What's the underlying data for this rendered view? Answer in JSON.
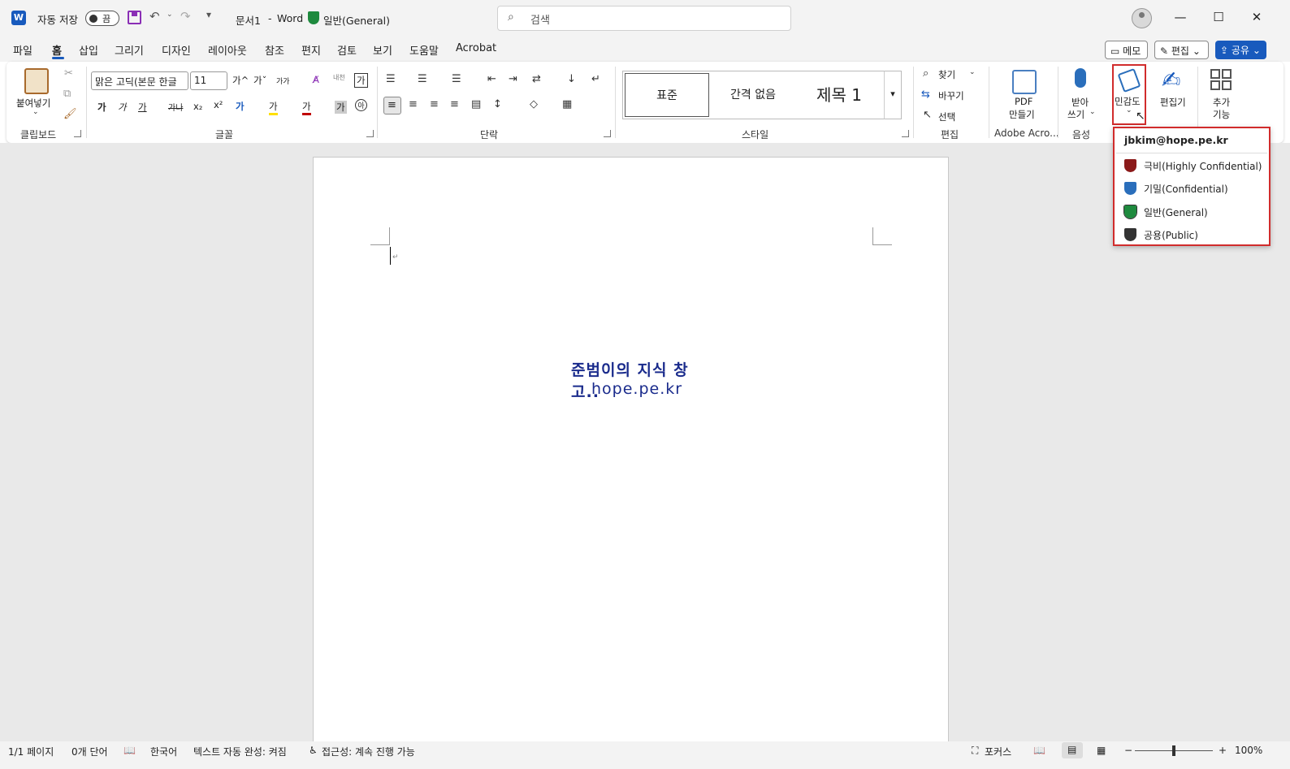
{
  "titlebar": {
    "app_icon": "W",
    "autosave_label": "자동 저장",
    "autosave_state": "끔",
    "doc_title": "문서1",
    "separator": "-",
    "app_name": "Word",
    "sensitivity_label": "일반(General)",
    "search_placeholder": "검색",
    "icons": [
      "save-icon",
      "undo-icon",
      "redo-icon",
      "customize-icon",
      "search-icon",
      "account-icon",
      "minimize-icon",
      "maximize-icon",
      "close-icon"
    ]
  },
  "tabs": [
    "파일",
    "홈",
    "삽입",
    "그리기",
    "디자인",
    "레이아웃",
    "참조",
    "편지",
    "검토",
    "보기",
    "도움말",
    "Acrobat"
  ],
  "active_tab": "홈",
  "top_buttons": {
    "memo": "메모",
    "edit": "편집",
    "share": "공유"
  },
  "ribbon": {
    "clipboard": {
      "paste_label": "붙여넣기",
      "group_label": "클립보드"
    },
    "font": {
      "font_name": "맑은 고딕(본문 한글",
      "font_size": "11",
      "row1": [
        "가^",
        "가ˇ",
        "가가",
        "내천",
        "가"
      ],
      "row2": [
        "가",
        "가",
        "가",
        "가나",
        "x₂",
        "x²",
        "가",
        "가",
        "가",
        "가"
      ],
      "group_label": "글꼴"
    },
    "paragraph": {
      "group_label": "단락"
    },
    "styles": {
      "items": [
        "표준",
        "간격 없음",
        "제목 1"
      ],
      "group_label": "스타일"
    },
    "editing": {
      "find": "찾기",
      "replace": "바꾸기",
      "select": "선택",
      "group_label": "편집"
    },
    "adobe": {
      "pdf_line1": "PDF",
      "pdf_line2": "만들기",
      "group_label": "Adobe Acro..."
    },
    "voice": {
      "dictate_line1": "받아",
      "dictate_line2": "쓰기",
      "group_label": "음성"
    },
    "sensitivity": {
      "label": "민감도"
    },
    "editor": {
      "label": "편집기"
    },
    "addins": {
      "line1": "추가",
      "line2": "기능"
    }
  },
  "sensitivity_menu": {
    "account": "jbkim@hope.pe.kr",
    "items": [
      {
        "label": "극비(Highly Confidential)",
        "color": "#8b1a1a"
      },
      {
        "label": "기밀(Confidential)",
        "color": "#2a6ebb"
      },
      {
        "label": "일반(General)",
        "color": "#1e8a3e"
      },
      {
        "label": "공용(Public)",
        "color": "#333333"
      }
    ]
  },
  "document": {
    "line1": "준범이의 지식 창고..",
    "line2": "hope.pe.kr"
  },
  "statusbar": {
    "page": "1/1 페이지",
    "words": "0개 단어",
    "language": "한국어",
    "autocomplete": "텍스트 자동 완성: 켜짐",
    "accessibility": "접근성: 계속 진행 가능",
    "focus": "포커스",
    "zoom_minus": "−",
    "zoom_plus": "+",
    "zoom": "100%"
  }
}
